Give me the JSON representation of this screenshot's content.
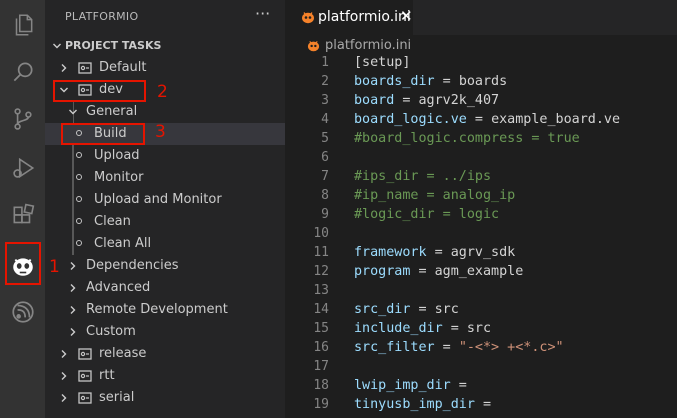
{
  "sidebar": {
    "title": "PLATFORMIO",
    "more": "···",
    "section": "PROJECT TASKS",
    "items": {
      "default": "Default",
      "dev": "dev",
      "general": "General",
      "build": "Build",
      "upload": "Upload",
      "monitor": "Monitor",
      "upload_monitor": "Upload and Monitor",
      "clean": "Clean",
      "clean_all": "Clean All",
      "dependencies": "Dependencies",
      "advanced": "Advanced",
      "remote": "Remote Development",
      "custom": "Custom",
      "release": "release",
      "rtt": "rtt",
      "serial": "serial"
    }
  },
  "annotations": {
    "one": "1",
    "two": "2",
    "three": "3"
  },
  "tab": {
    "label": "platformio.ini",
    "close": "✕"
  },
  "breadcrumb": {
    "label": "platformio.ini"
  },
  "code": [
    {
      "n": "1",
      "t": "[setup]"
    },
    {
      "n": "2",
      "t": "boards_dir = boards"
    },
    {
      "n": "3",
      "t": "board = agrv2k_407"
    },
    {
      "n": "4",
      "t": "board_logic.ve = example_board.ve"
    },
    {
      "n": "5",
      "t": "#board_logic.compress = true"
    },
    {
      "n": "6",
      "t": ""
    },
    {
      "n": "7",
      "t": "#ips_dir = ../ips"
    },
    {
      "n": "8",
      "t": "#ip_name = analog_ip"
    },
    {
      "n": "9",
      "t": "#logic_dir = logic"
    },
    {
      "n": "10",
      "t": ""
    },
    {
      "n": "11",
      "t": "framework = agrv_sdk"
    },
    {
      "n": "12",
      "t": "program = agm_example"
    },
    {
      "n": "13",
      "t": ""
    },
    {
      "n": "14",
      "t": "src_dir = src"
    },
    {
      "n": "15",
      "t": "include_dir = src"
    },
    {
      "n": "16",
      "t": "src_filter = \"-<*> +<*.c>\""
    },
    {
      "n": "17",
      "t": ""
    },
    {
      "n": "18",
      "t": "lwip_imp_dir ="
    },
    {
      "n": "19",
      "t": "tinyusb_imp_dir ="
    }
  ],
  "colors": {
    "annotation": "#e51400",
    "key": "#9cdcfe",
    "comment": "#6a9955",
    "string": "#ce9178"
  }
}
